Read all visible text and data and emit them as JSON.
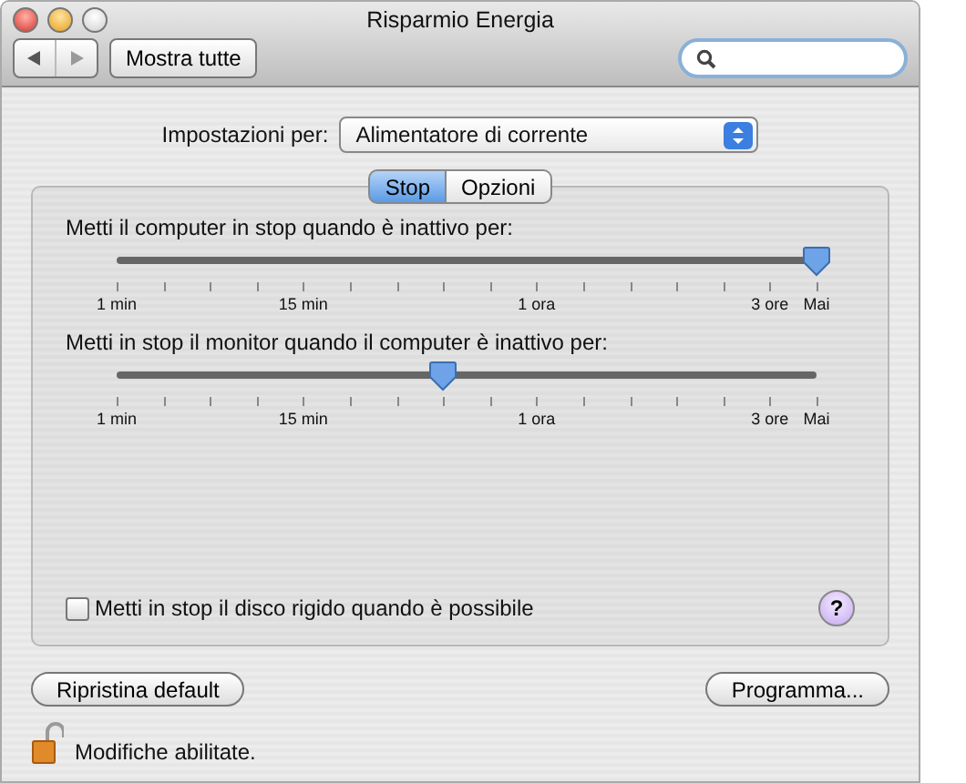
{
  "window": {
    "title": "Risparmio Energia"
  },
  "toolbar": {
    "show_all": "Mostra tutte"
  },
  "settings_for": {
    "label": "Impostazioni per:",
    "value": "Alimentatore di corrente"
  },
  "tabs": [
    {
      "label": "Stop",
      "selected": true
    },
    {
      "label": "Opzioni",
      "selected": false
    }
  ],
  "sliders": [
    {
      "label": "Metti il computer in stop quando è inattivo per:",
      "level": 1.0,
      "ticks": [
        "1 min",
        "15 min",
        "1 ora",
        "3 ore",
        "Mai"
      ]
    },
    {
      "label": "Metti in stop il monitor quando il computer è inattivo per:",
      "level": 0.467,
      "ticks": [
        "1 min",
        "15 min",
        "1 ora",
        "3 ore",
        "Mai"
      ]
    }
  ],
  "disk_sleep": {
    "label": "Metti in stop il disco rigido quando è possibile",
    "checked": false
  },
  "help": "?",
  "buttons": {
    "restore": "Ripristina default",
    "schedule": "Programma..."
  },
  "lock": {
    "text": "Modifiche abilitate.",
    "locked": false
  }
}
